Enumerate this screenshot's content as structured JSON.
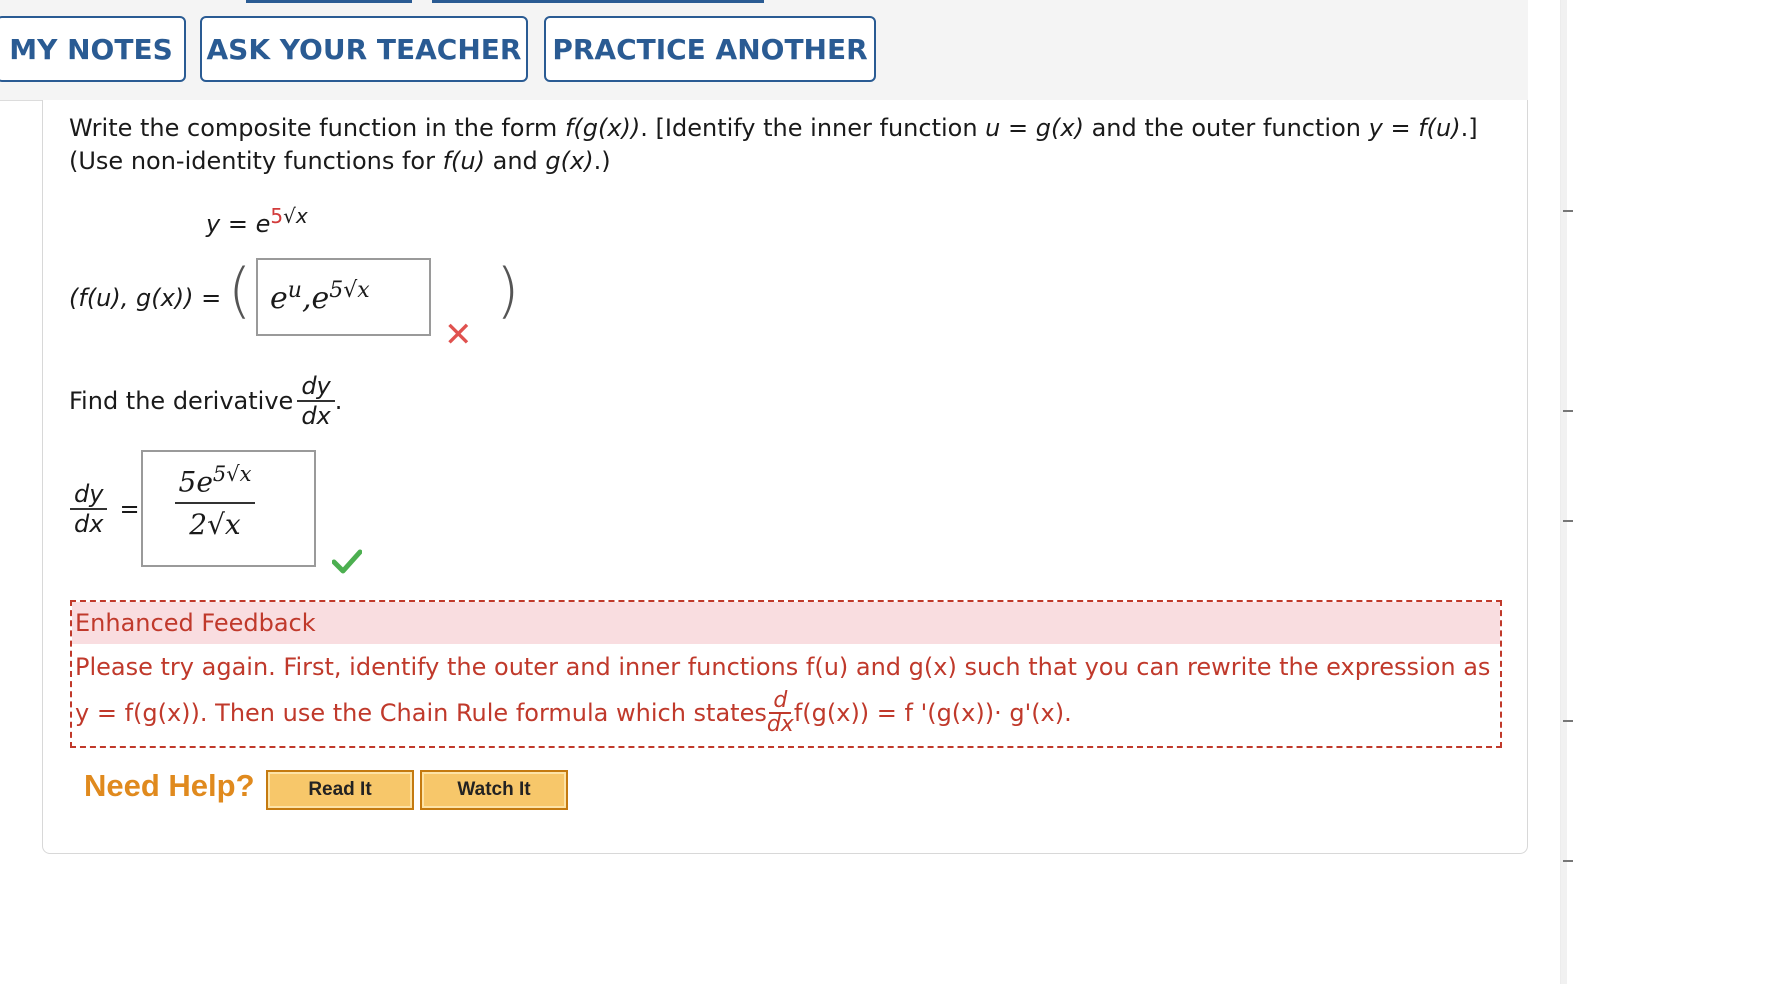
{
  "toolbar": {
    "my_notes": "MY NOTES",
    "ask_teacher": "ASK YOUR TEACHER",
    "practice_another": "PRACTICE ANOTHER"
  },
  "question": {
    "p1": "Write the composite function in the form ",
    "fgx": "f(g(x))",
    "p2": ". [Identify the inner function ",
    "u": "u",
    "eq1": " = ",
    "gx": "g(x)",
    "p3": " and the outer function ",
    "y": "y",
    "eq2": " = ",
    "fu": "f(u)",
    "p4": ".] (Use non-identity functions for ",
    "fu2": "f(u)",
    "and": " and ",
    "gx2": "g(x)",
    "p5": ".)"
  },
  "equation": {
    "lhs": "y = e",
    "exp_five": "5",
    "exp_root": "√x"
  },
  "pair": {
    "label": "(f(u), g(x)) =",
    "answer_base1": "e",
    "answer_sup1": "u",
    "answer_sep": ",",
    "answer_base2": "e",
    "answer_sup2": "5√x",
    "status": "incorrect"
  },
  "derivative_prompt": {
    "text": "Find the derivative ",
    "num": "dy",
    "den": "dx",
    "period": "."
  },
  "derivative": {
    "lhs_num": "dy",
    "lhs_den": "dx",
    "eq": "=",
    "ans_num_coef": "5e",
    "ans_num_sup": "5√x",
    "ans_den": "2√x",
    "status": "correct"
  },
  "feedback": {
    "title": "Enhanced Feedback",
    "line1": "Please try again. First, identify the outer and inner functions f(u) and g(x) such that you can rewrite the expression as",
    "line2a": "y = f(g(x)). Then use the Chain Rule formula which states ",
    "d_num": "d",
    "d_den": "dx",
    "line2b": "f(g(x)) = f '(g(x))· g'(x)."
  },
  "help": {
    "label": "Need Help?",
    "read_it": "Read It",
    "watch_it": "Watch It"
  },
  "colors": {
    "accent": "#2a5b93",
    "error": "#d23b3b",
    "success": "#4caf50",
    "help": "#e08a1e"
  }
}
